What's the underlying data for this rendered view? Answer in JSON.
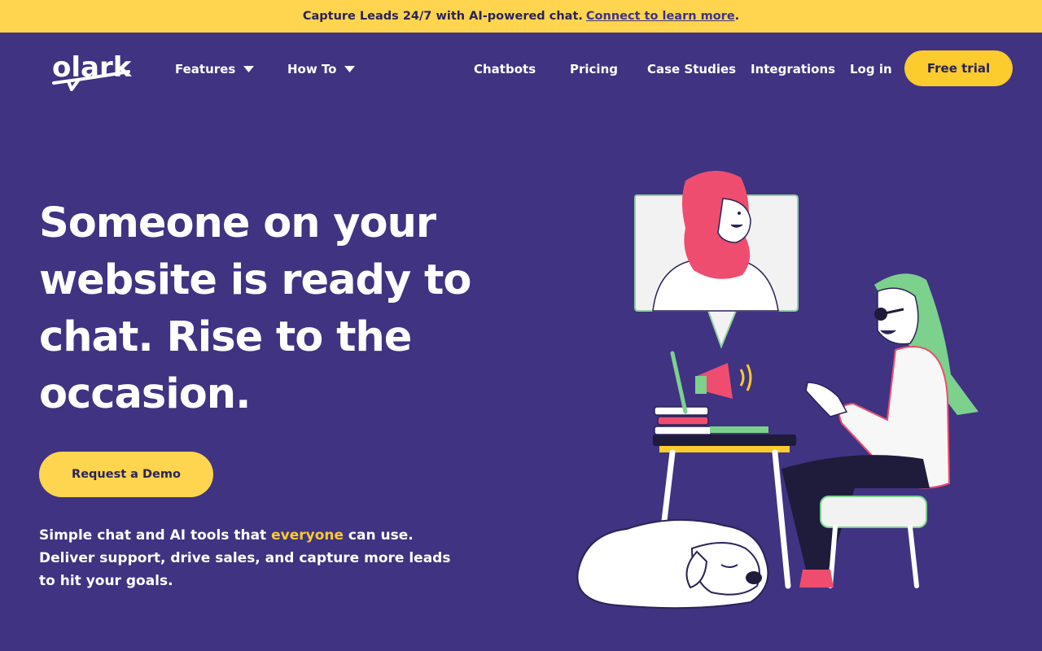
{
  "announcement": {
    "text": "Capture Leads 24/7 with AI-powered chat.",
    "link": "Connect to learn more",
    "suffix": "."
  },
  "header": {
    "logo_text": "olark",
    "nav": {
      "features": "Features",
      "how_to": "How To",
      "chatbots": "Chatbots",
      "pricing": "Pricing",
      "case_studies": "Case Studies",
      "integrations": "Integrations",
      "log_in": "Log in"
    },
    "cta": "Free trial"
  },
  "hero": {
    "title": "Someone on your website is ready to chat. Rise to the occasion.",
    "demo_button": "Request a Demo",
    "subtitle_before": "Simple chat and AI tools that ",
    "subtitle_highlight": "everyone",
    "subtitle_after": " can use. Deliver support, drive sales, and capture more leads to hit your goals."
  },
  "colors": {
    "background": "#3f3382",
    "accent_yellow": "#fccb2d",
    "banner_yellow": "#ffd44e",
    "text_dark": "#2a2357"
  }
}
